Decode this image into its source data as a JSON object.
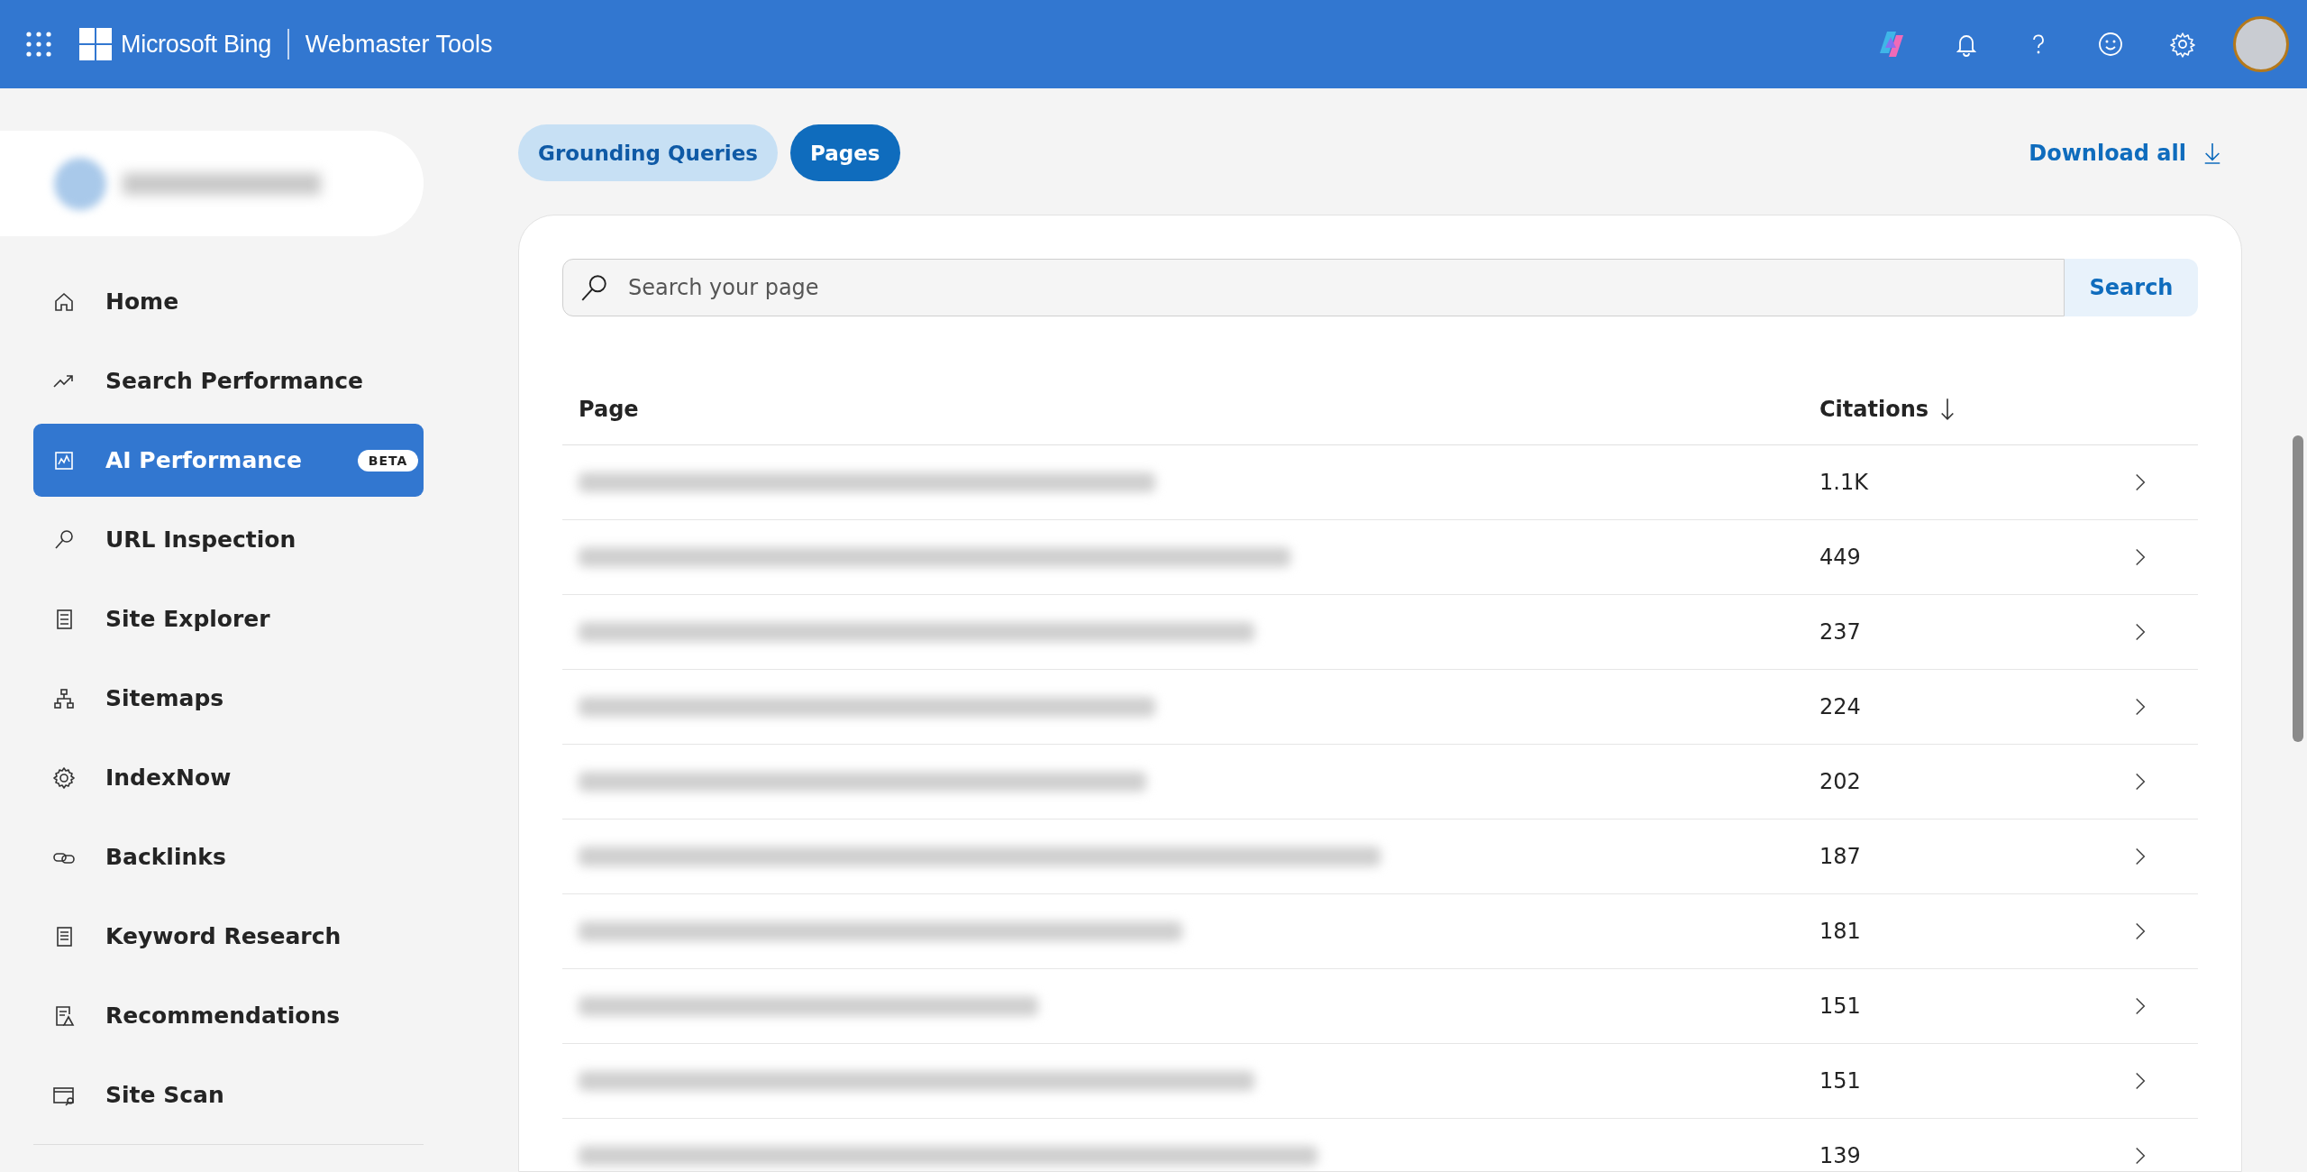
{
  "header": {
    "brand": "Microsoft Bing",
    "product": "Webmaster Tools"
  },
  "sidebar": {
    "items": [
      {
        "label": "Home",
        "selected": false
      },
      {
        "label": "Search Performance",
        "selected": false
      },
      {
        "label": "AI Performance",
        "selected": true,
        "badge": "BETA"
      },
      {
        "label": "URL Inspection",
        "selected": false
      },
      {
        "label": "Site Explorer",
        "selected": false
      },
      {
        "label": "Sitemaps",
        "selected": false
      },
      {
        "label": "IndexNow",
        "selected": false
      },
      {
        "label": "Backlinks",
        "selected": false
      },
      {
        "label": "Keyword Research",
        "selected": false
      },
      {
        "label": "Recommendations",
        "selected": false
      },
      {
        "label": "Site Scan",
        "selected": false
      }
    ]
  },
  "tabs": [
    {
      "label": "Grounding Queries",
      "selected": false
    },
    {
      "label": "Pages",
      "selected": true
    }
  ],
  "download": "Download all",
  "search": {
    "placeholder": "Search your page",
    "button": "Search"
  },
  "table": {
    "columns": [
      "Page",
      "Citations"
    ],
    "rows": [
      {
        "citations": "1.1K"
      },
      {
        "citations": "449"
      },
      {
        "citations": "237"
      },
      {
        "citations": "224"
      },
      {
        "citations": "202"
      },
      {
        "citations": "187"
      },
      {
        "citations": "181"
      },
      {
        "citations": "151"
      },
      {
        "citations": "151"
      },
      {
        "citations": "139"
      }
    ]
  }
}
